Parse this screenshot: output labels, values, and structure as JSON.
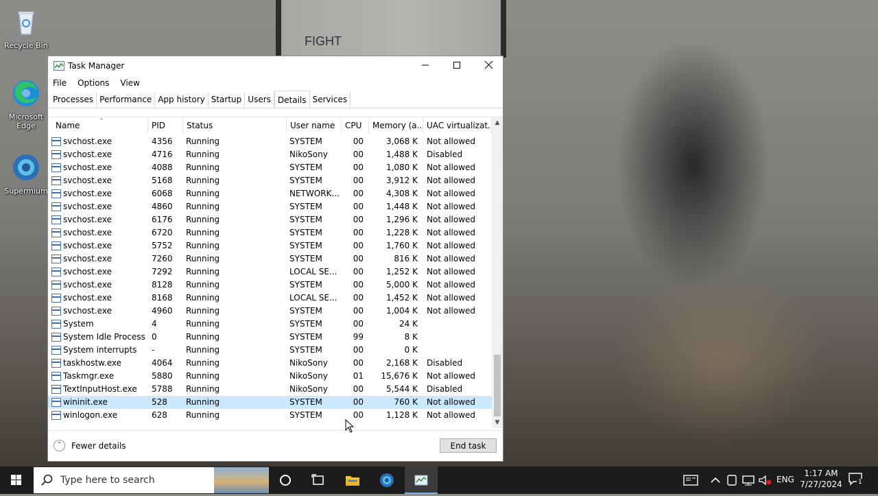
{
  "desktop": {
    "wall_text": "FIGHT",
    "icons": [
      {
        "label": "Recycle Bin",
        "icon": "recycle-bin-icon"
      },
      {
        "label": "Microsoft Edge",
        "icon": "edge-icon"
      },
      {
        "label": "Supermium",
        "icon": "supermium-icon"
      }
    ]
  },
  "window": {
    "title": "Task Manager",
    "menu": [
      "File",
      "Options",
      "View"
    ],
    "tabs": [
      "Processes",
      "Performance",
      "App history",
      "Startup",
      "Users",
      "Details",
      "Services"
    ],
    "active_tab": "Details",
    "columns": [
      "Name",
      "PID",
      "Status",
      "User name",
      "CPU",
      "Memory (a...",
      "UAC virtualizat..."
    ],
    "rows": [
      {
        "name": "svchost.exe",
        "pid": "4356",
        "status": "Running",
        "user": "SYSTEM",
        "cpu": "00",
        "memory": "3,068 K",
        "uac": "Not allowed"
      },
      {
        "name": "svchost.exe",
        "pid": "4716",
        "status": "Running",
        "user": "NikoSony",
        "cpu": "00",
        "memory": "1,488 K",
        "uac": "Disabled"
      },
      {
        "name": "svchost.exe",
        "pid": "4088",
        "status": "Running",
        "user": "SYSTEM",
        "cpu": "00",
        "memory": "1,080 K",
        "uac": "Not allowed"
      },
      {
        "name": "svchost.exe",
        "pid": "5168",
        "status": "Running",
        "user": "SYSTEM",
        "cpu": "00",
        "memory": "3,912 K",
        "uac": "Not allowed"
      },
      {
        "name": "svchost.exe",
        "pid": "6068",
        "status": "Running",
        "user": "NETWORK...",
        "cpu": "00",
        "memory": "4,308 K",
        "uac": "Not allowed"
      },
      {
        "name": "svchost.exe",
        "pid": "4860",
        "status": "Running",
        "user": "SYSTEM",
        "cpu": "00",
        "memory": "1,448 K",
        "uac": "Not allowed"
      },
      {
        "name": "svchost.exe",
        "pid": "6176",
        "status": "Running",
        "user": "SYSTEM",
        "cpu": "00",
        "memory": "1,296 K",
        "uac": "Not allowed"
      },
      {
        "name": "svchost.exe",
        "pid": "6720",
        "status": "Running",
        "user": "SYSTEM",
        "cpu": "00",
        "memory": "1,228 K",
        "uac": "Not allowed"
      },
      {
        "name": "svchost.exe",
        "pid": "5752",
        "status": "Running",
        "user": "SYSTEM",
        "cpu": "00",
        "memory": "1,760 K",
        "uac": "Not allowed"
      },
      {
        "name": "svchost.exe",
        "pid": "7260",
        "status": "Running",
        "user": "SYSTEM",
        "cpu": "00",
        "memory": "816 K",
        "uac": "Not allowed"
      },
      {
        "name": "svchost.exe",
        "pid": "7292",
        "status": "Running",
        "user": "LOCAL SE...",
        "cpu": "00",
        "memory": "1,252 K",
        "uac": "Not allowed"
      },
      {
        "name": "svchost.exe",
        "pid": "8128",
        "status": "Running",
        "user": "SYSTEM",
        "cpu": "00",
        "memory": "5,000 K",
        "uac": "Not allowed"
      },
      {
        "name": "svchost.exe",
        "pid": "8168",
        "status": "Running",
        "user": "LOCAL SE...",
        "cpu": "00",
        "memory": "1,452 K",
        "uac": "Not allowed"
      },
      {
        "name": "svchost.exe",
        "pid": "4960",
        "status": "Running",
        "user": "SYSTEM",
        "cpu": "00",
        "memory": "1,004 K",
        "uac": "Not allowed"
      },
      {
        "name": "System",
        "pid": "4",
        "status": "Running",
        "user": "SYSTEM",
        "cpu": "00",
        "memory": "24 K",
        "uac": ""
      },
      {
        "name": "System Idle Process",
        "pid": "0",
        "status": "Running",
        "user": "SYSTEM",
        "cpu": "99",
        "memory": "8 K",
        "uac": ""
      },
      {
        "name": "System interrupts",
        "pid": "-",
        "status": "Running",
        "user": "SYSTEM",
        "cpu": "00",
        "memory": "0 K",
        "uac": ""
      },
      {
        "name": "taskhostw.exe",
        "pid": "4064",
        "status": "Running",
        "user": "NikoSony",
        "cpu": "00",
        "memory": "2,168 K",
        "uac": "Disabled"
      },
      {
        "name": "Taskmgr.exe",
        "pid": "5880",
        "status": "Running",
        "user": "NikoSony",
        "cpu": "01",
        "memory": "15,676 K",
        "uac": "Not allowed"
      },
      {
        "name": "TextInputHost.exe",
        "pid": "5788",
        "status": "Running",
        "user": "NikoSony",
        "cpu": "00",
        "memory": "5,544 K",
        "uac": "Disabled"
      },
      {
        "name": "wininit.exe",
        "pid": "528",
        "status": "Running",
        "user": "SYSTEM",
        "cpu": "00",
        "memory": "760 K",
        "uac": "Not allowed",
        "selected": true
      },
      {
        "name": "winlogon.exe",
        "pid": "628",
        "status": "Running",
        "user": "SYSTEM",
        "cpu": "00",
        "memory": "1,128 K",
        "uac": "Not allowed"
      }
    ],
    "footer": {
      "fewer_details": "Fewer details",
      "end_task": "End task"
    }
  },
  "taskbar": {
    "search_placeholder": "Type here to search",
    "tray": {
      "language": "ENG",
      "time": "1:17 AM",
      "date": "7/27/2024",
      "notification_count": "1"
    }
  },
  "colors": {
    "selected_row": "#cce8ff",
    "taskbar": "#1c1c1c",
    "accent": "#7bb3e8"
  }
}
